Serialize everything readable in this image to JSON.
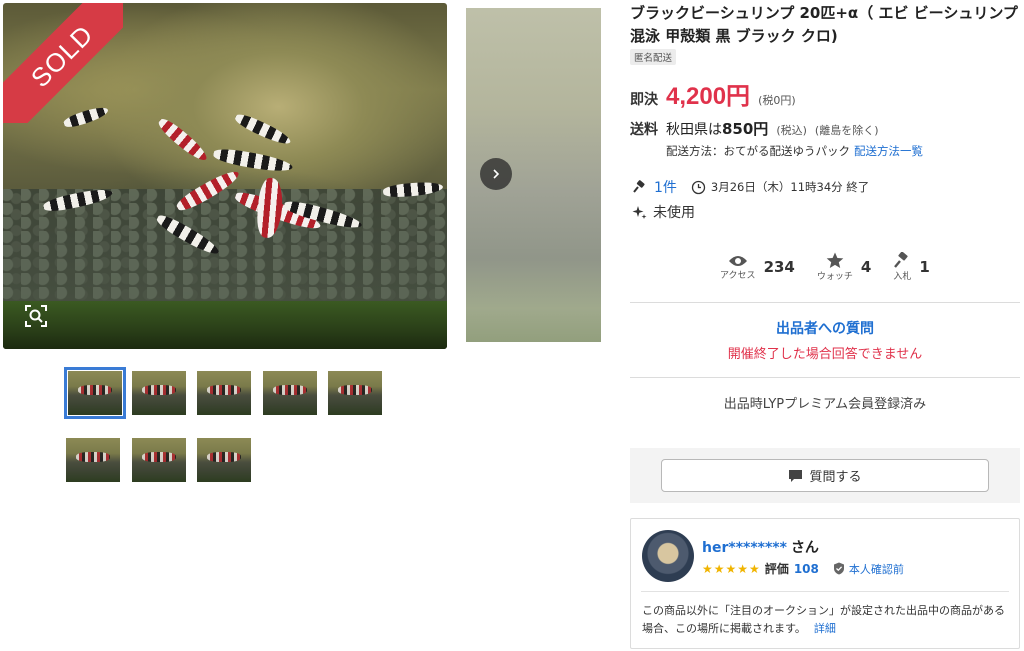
{
  "gallery": {
    "sold_label": "SOLD",
    "thumbnail_count": 8,
    "selected_thumbnail": 1
  },
  "item": {
    "title": "ブラックビーシュリンプ 20匹+α（ エビ ビーシュリンプ 混泳 甲殻類 黒 ブラック クロ)",
    "anon_shipping_tag": "匿名配送"
  },
  "price": {
    "label": "即決",
    "value": "4,200円",
    "tax_note": "(税0円)"
  },
  "shipping": {
    "label": "送料",
    "destination": "秋田県は",
    "price": "850円",
    "tax_note": "(税込)",
    "exclusion": "(離島を除く)",
    "method_text": "配送方法：おてがる配送ゆうパック",
    "method_link": "配送方法一覧"
  },
  "auction": {
    "bids": "1件",
    "end_time": "3月26日（木）11時34分 終了",
    "condition": "未使用"
  },
  "stats": {
    "access_label": "アクセス",
    "access_value": "234",
    "watch_label": "ウォッチ",
    "watch_value": "4",
    "bid_label": "入札",
    "bid_value": "1"
  },
  "question": {
    "title": "出品者への質問",
    "closed_message": "開催終了した場合回答できません",
    "premium_note": "出品時LYPプレミアム会員登録済み",
    "ask_button": "質問する"
  },
  "seller": {
    "name": "her********",
    "honorific": "さん",
    "stars": "★★★★★",
    "rating_label": "評価",
    "rating_value": "108",
    "verify_text": "本人確認前",
    "note": "この商品以外に「注目のオークション」が設定された出品中の商品がある場合、この場所に掲載されます。",
    "note_link": "詳細"
  },
  "colors": {
    "accent_blue": "#1f6fd1",
    "price_red": "#e0324b",
    "sold_red": "#d63b45",
    "star_gold": "#f0b400"
  }
}
